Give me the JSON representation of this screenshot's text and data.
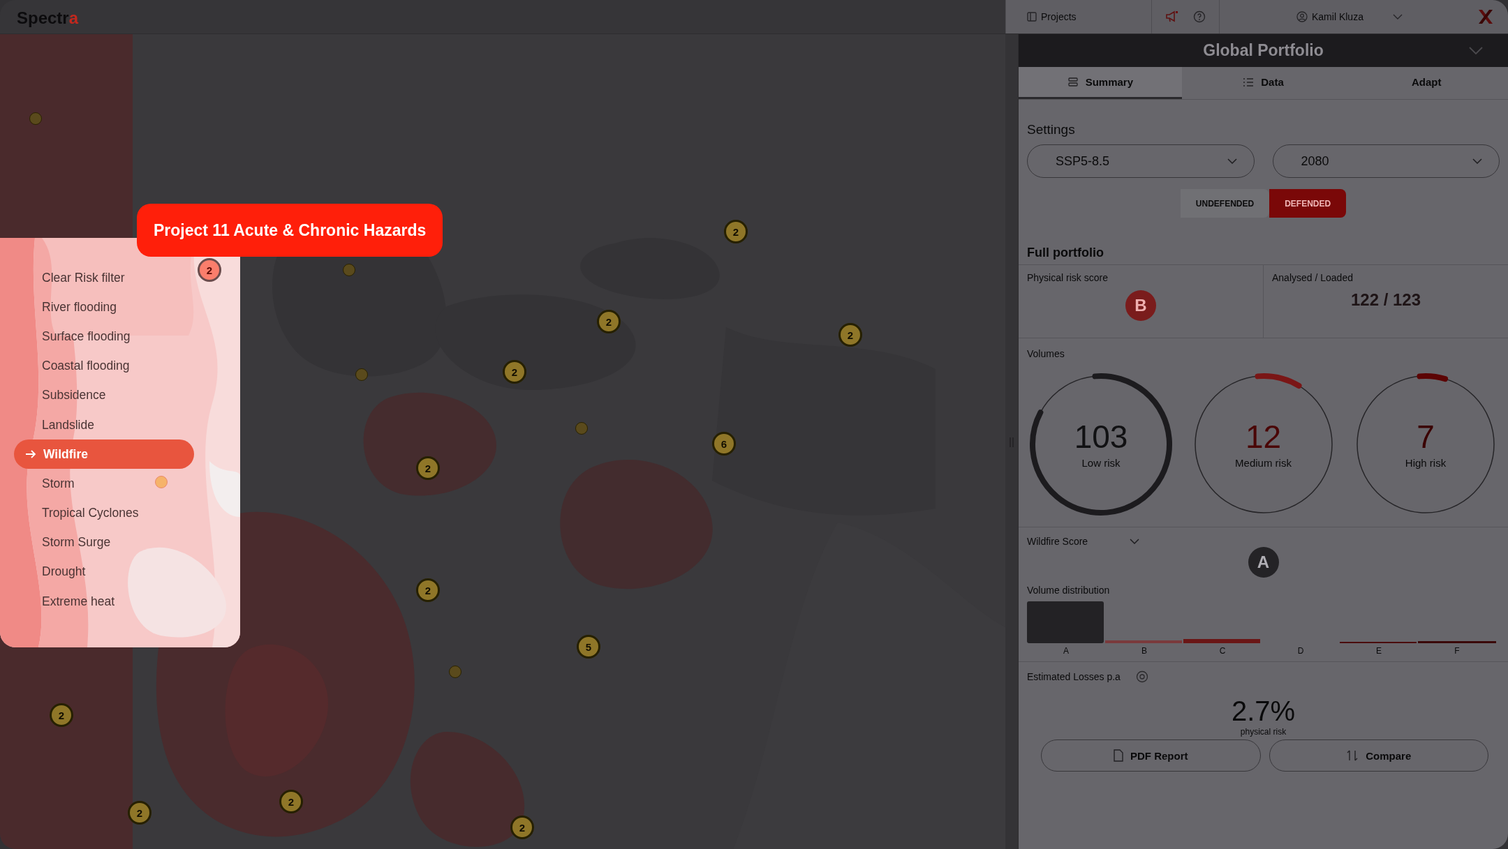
{
  "top_bar": {
    "logo": "Spectra",
    "projects": "Projects",
    "user": "Kamil Kluza"
  },
  "map": {
    "clusters": [
      {
        "count": "2"
      },
      {
        "count": "2"
      },
      {
        "count": "2"
      },
      {
        "count": "2"
      },
      {
        "count": "2"
      },
      {
        "count": "6"
      },
      {
        "count": "2"
      },
      {
        "count": "2"
      },
      {
        "count": "5"
      },
      {
        "count": "2"
      },
      {
        "count": "2"
      },
      {
        "count": "2"
      },
      {
        "count": "2"
      }
    ]
  },
  "hazard_menu": {
    "title": "Project 11 Acute & Chronic Hazards",
    "items": [
      {
        "label": "Clear Risk filter",
        "selected": false
      },
      {
        "label": "River flooding",
        "selected": false
      },
      {
        "label": "Surface flooding",
        "selected": false
      },
      {
        "label": "Coastal flooding",
        "selected": false
      },
      {
        "label": "Subsidence",
        "selected": false
      },
      {
        "label": "Landslide",
        "selected": false
      },
      {
        "label": "Wildfire",
        "selected": true
      },
      {
        "label": "Storm",
        "selected": false
      },
      {
        "label": "Tropical Cyclones",
        "selected": false
      },
      {
        "label": "Storm Surge",
        "selected": false
      },
      {
        "label": "Drought",
        "selected": false
      },
      {
        "label": "Extreme heat",
        "selected": false
      }
    ]
  },
  "panel": {
    "title": "Global Portfolio",
    "tabs": [
      {
        "label": "Summary",
        "selected": true
      },
      {
        "label": "Data",
        "selected": false
      },
      {
        "label": "Adapt",
        "selected": false
      }
    ],
    "settings": {
      "label": "Settings",
      "scenario": "SSP5-8.5",
      "year": "2080",
      "defence": [
        {
          "label": "UNDEFENDED",
          "selected": false
        },
        {
          "label": "DEFENDED",
          "selected": true
        }
      ]
    },
    "full_portfolio": {
      "label": "Full portfolio",
      "physical_risk_label": "Physical risk score",
      "physical_risk_grade": "B",
      "analysed_label": "Analysed / Loaded",
      "analysed_value": "122 / 123"
    },
    "volumes": {
      "label": "Volumes",
      "rings": [
        {
          "value": "103",
          "label": "Low risk",
          "level": 0.84,
          "kind": "low"
        },
        {
          "value": "12",
          "label": "Medium risk",
          "level": 0.1,
          "kind": "medium"
        },
        {
          "value": "7",
          "label": "High risk",
          "level": 0.06,
          "kind": "high"
        }
      ]
    },
    "score": {
      "label": "Wildfire Score",
      "grade": "A"
    },
    "volume_distribution": {
      "label": "Volume distribution",
      "categories": [
        "A",
        "B",
        "C",
        "D",
        "E",
        "F"
      ]
    },
    "losses": {
      "label": "Estimated Losses p.a",
      "value": "2.7%",
      "caption": "physical risk"
    },
    "buttons": [
      {
        "label": "PDF Report",
        "kind": "report"
      },
      {
        "label": "Compare",
        "kind": "compare"
      }
    ]
  }
}
